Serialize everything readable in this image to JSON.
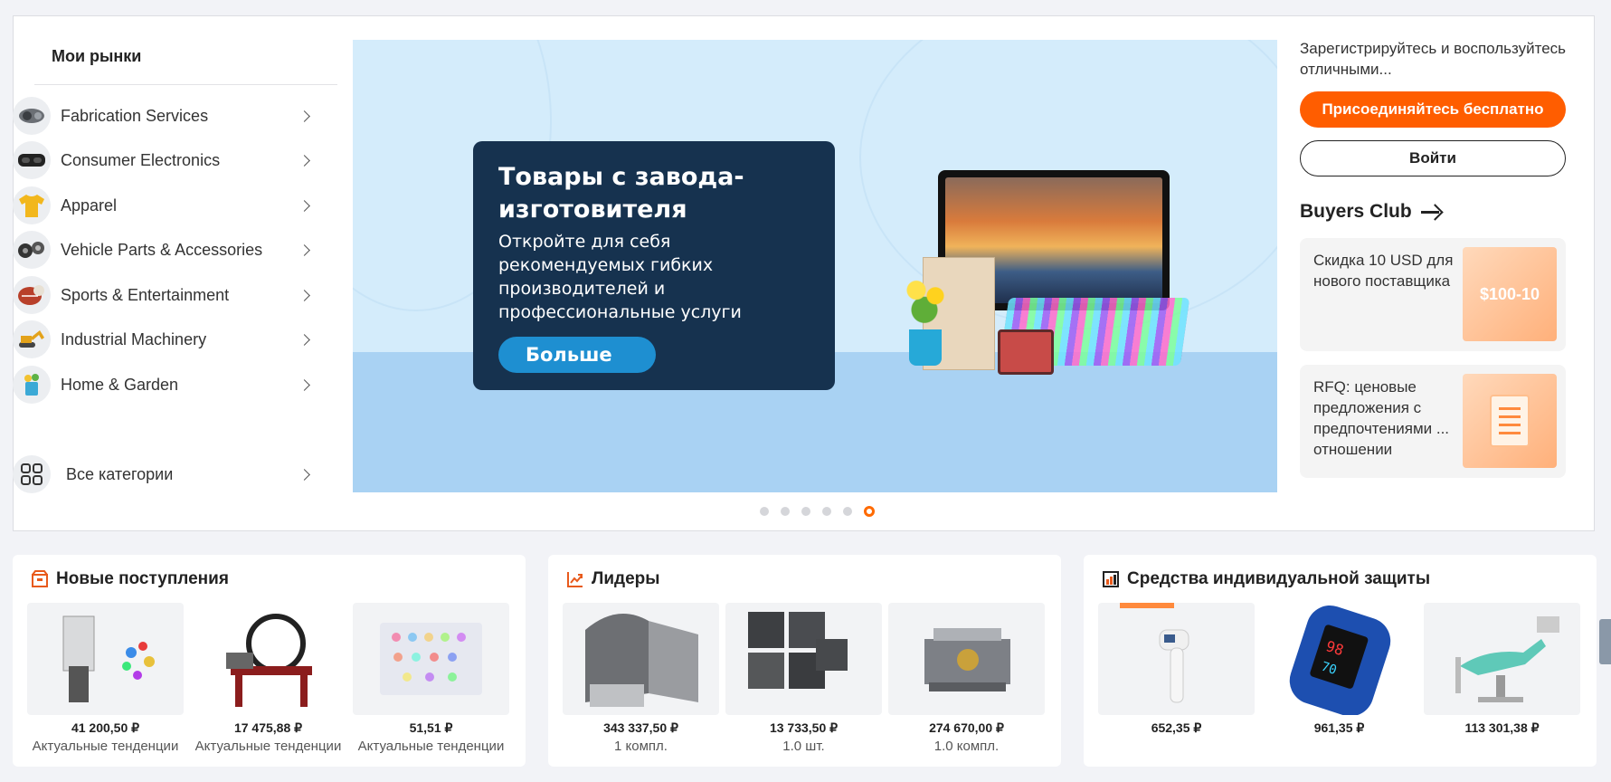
{
  "sidebar": {
    "title": "Мои рынки",
    "categories": [
      {
        "label": "Fabrication Services",
        "icon": "gear-parts-icon"
      },
      {
        "label": "Consumer Electronics",
        "icon": "vr-headset-icon"
      },
      {
        "label": "Apparel",
        "icon": "tshirt-icon"
      },
      {
        "label": "Vehicle Parts & Accessories",
        "icon": "car-parts-icon"
      },
      {
        "label": "Sports & Entertainment",
        "icon": "sports-ball-icon"
      },
      {
        "label": "Industrial Machinery",
        "icon": "excavator-icon"
      },
      {
        "label": "Home & Garden",
        "icon": "garden-icon"
      },
      {
        "label": "Все категории",
        "icon": "grid-icon"
      }
    ]
  },
  "banner": {
    "title": "Товары с завода-изготовителя",
    "subtitle": "Откройте для себя рекомендуемых гибких производителей и профессиональные услуги",
    "cta": "Больше",
    "slide_count": 6,
    "active_slide": 6
  },
  "account": {
    "register_text": "Зарегистрируйтесь и воспользуйтесь отличными...",
    "join_label": "Присоединяйтесь бесплатно",
    "login_label": "Войти",
    "club_label": "Buyers Club",
    "perks": [
      {
        "text": "Скидка 10 USD для нового поставщика",
        "badge": "$100-10"
      },
      {
        "text": "RFQ: ценовые предложения с предпочтениями ... отношении",
        "badge": ""
      }
    ]
  },
  "sections": [
    {
      "title": "Новые поступления",
      "icon": "box-icon",
      "products": [
        {
          "price": "41 200,50 ₽",
          "sub": "Актуальные тенденции"
        },
        {
          "price": "17 475,88 ₽",
          "sub": "Актуальные тенденции"
        },
        {
          "price": "51,51 ₽",
          "sub": "Актуальные тенденции"
        }
      ]
    },
    {
      "title": "Лидеры",
      "icon": "trend-up-icon",
      "products": [
        {
          "price": "343 337,50 ₽",
          "sub": "1 компл."
        },
        {
          "price": "13 733,50 ₽",
          "sub": "1.0 шт."
        },
        {
          "price": "274 670,00 ₽",
          "sub": "1.0 компл."
        }
      ]
    },
    {
      "title": "Средства индивидуальной защиты",
      "icon": "building-chart-icon",
      "products": [
        {
          "price": "652,35 ₽",
          "sub": ""
        },
        {
          "price": "961,35 ₽",
          "sub": ""
        },
        {
          "price": "113 301,38 ₽",
          "sub": ""
        }
      ]
    }
  ],
  "colors": {
    "accent": "#ff5d00",
    "banner_bg": "#d4ecfb",
    "promo_bg": "#16324f",
    "cta_blue": "#1e8fd1"
  }
}
